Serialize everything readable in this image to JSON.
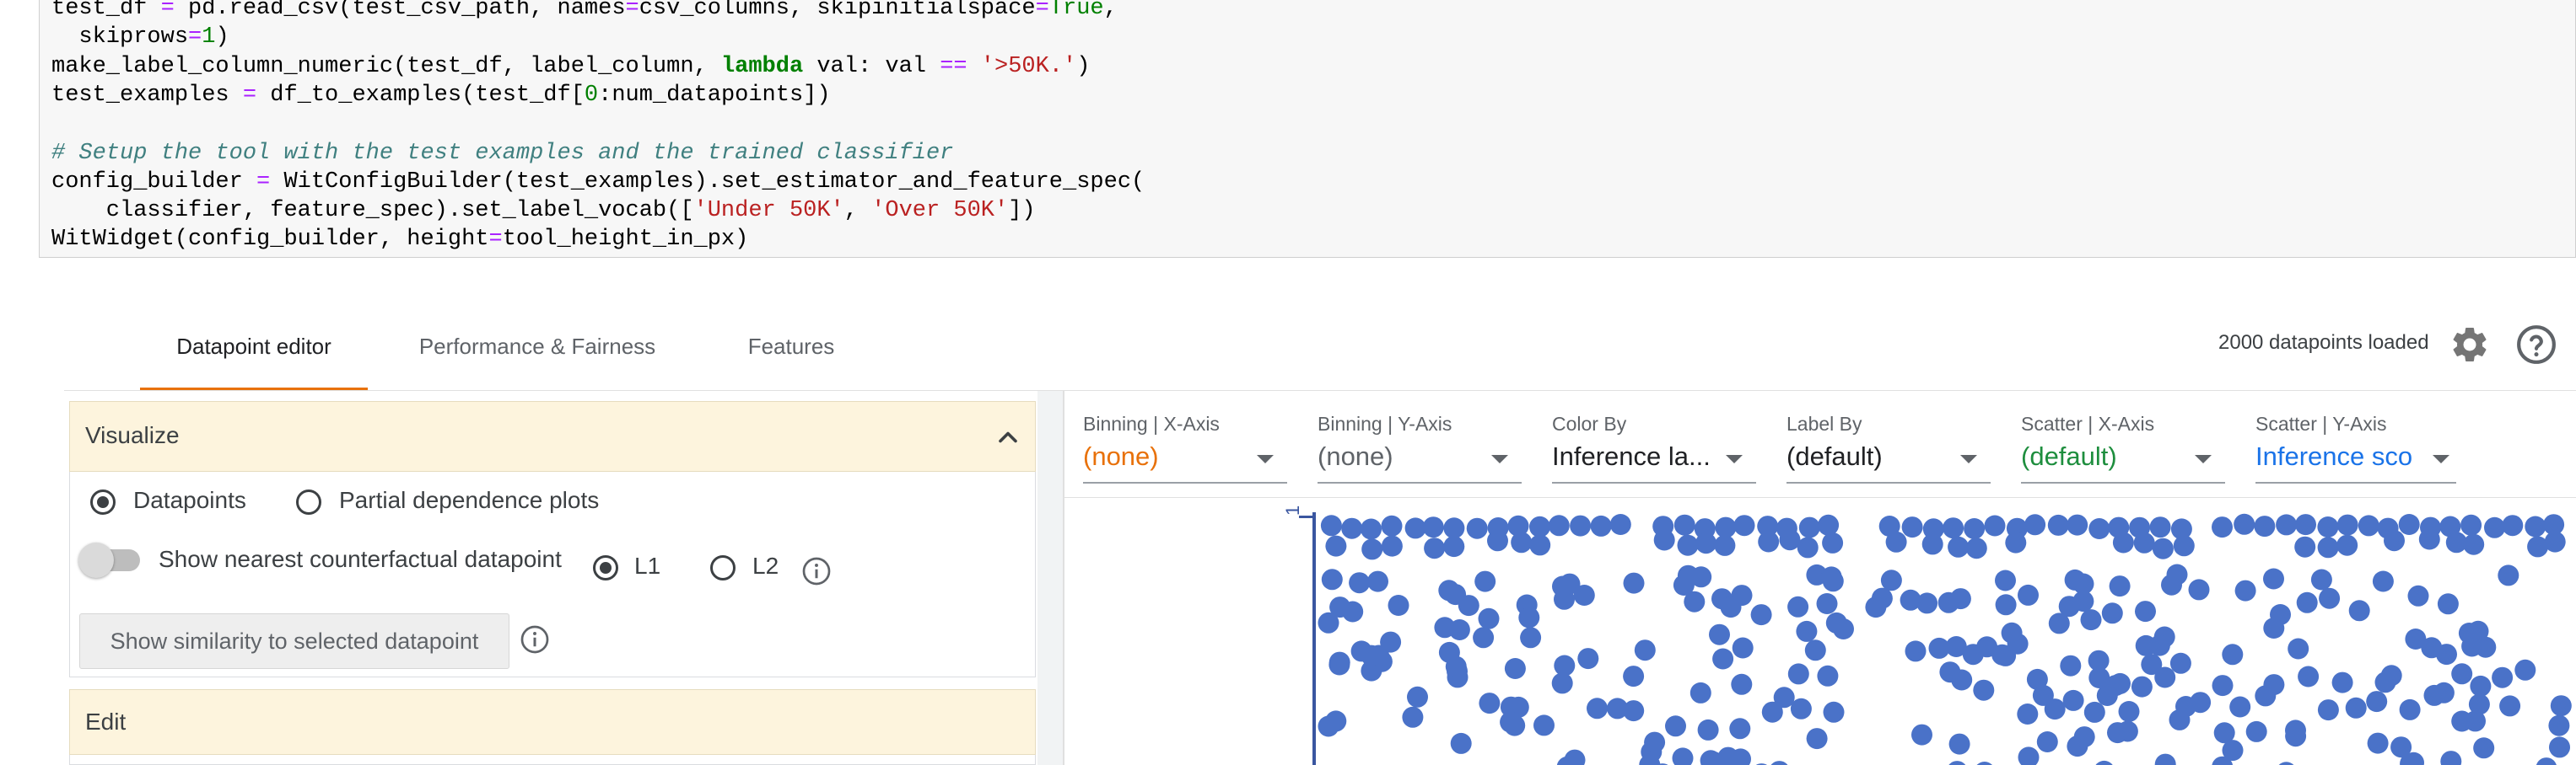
{
  "code": {
    "lines": [
      [
        [
          "",
          "test_df "
        ],
        [
          "op",
          "="
        ],
        [
          "",
          " pd.read_csv(test_csv_path, names"
        ],
        [
          "op",
          "="
        ],
        [
          "",
          "csv_columns, skipinitialspace"
        ],
        [
          "op",
          "="
        ],
        [
          "const",
          "True"
        ],
        [
          "",
          ","
        ]
      ],
      [
        [
          "",
          "  skiprows"
        ],
        [
          "op",
          "="
        ],
        [
          "num",
          "1"
        ],
        [
          "",
          ")"
        ]
      ],
      [
        [
          "",
          "make_label_column_numeric(test_df, label_column, "
        ],
        [
          "kw",
          "lambda"
        ],
        [
          "",
          " val: val "
        ],
        [
          "op",
          "=="
        ],
        [
          "",
          " "
        ],
        [
          "str",
          "'>50K.'"
        ],
        [
          "",
          ")"
        ]
      ],
      [
        [
          "",
          "test_examples "
        ],
        [
          "op",
          "="
        ],
        [
          "",
          " df_to_examples(test_df["
        ],
        [
          "num",
          "0"
        ],
        [
          "",
          ":num_datapoints])"
        ]
      ],
      [
        [
          "",
          ""
        ]
      ],
      [
        [
          "cm",
          "# Setup the tool with the test examples and the trained classifier"
        ]
      ],
      [
        [
          "",
          "config_builder "
        ],
        [
          "op",
          "="
        ],
        [
          "",
          " WitConfigBuilder(test_examples).set_estimator_and_feature_spec("
        ]
      ],
      [
        [
          "",
          "    classifier, feature_spec).set_label_vocab(["
        ],
        [
          "str",
          "'Under 50K'"
        ],
        [
          "",
          ", "
        ],
        [
          "str",
          "'Over 50K'"
        ],
        [
          "",
          "])"
        ]
      ],
      [
        [
          "",
          "WitWidget(config_builder, height"
        ],
        [
          "op",
          "="
        ],
        [
          "",
          "tool_height_in_px)"
        ]
      ]
    ]
  },
  "tabs": [
    {
      "label": "Datapoint editor",
      "active": true
    },
    {
      "label": "Performance & Fairness",
      "active": false
    },
    {
      "label": "Features",
      "active": false
    }
  ],
  "status": {
    "loaded_text": "2000 datapoints loaded"
  },
  "icons": {
    "settings": "gear-icon",
    "help": "help-circle-icon",
    "collapse": "chevron-up-icon",
    "info": "info-icon"
  },
  "visualize": {
    "title": "Visualize",
    "datapoints_label": "Datapoints",
    "datapoints_selected": true,
    "pdp_label": "Partial dependence plots",
    "pdp_selected": false,
    "counterfactual_label": "Show nearest counterfactual datapoint",
    "counterfactual_on": false,
    "l1_label": "L1",
    "l1_selected": true,
    "l2_label": "L2",
    "l2_selected": false,
    "similarity_button": "Show similarity to selected datapoint"
  },
  "edit": {
    "title": "Edit"
  },
  "controls": [
    {
      "label": "Binning | X-Axis",
      "value": "(none)",
      "color": "#e8710a"
    },
    {
      "label": "Binning | Y-Axis",
      "value": "(none)",
      "color": "#5f6368"
    },
    {
      "label": "Color By",
      "value": "Inference la...",
      "color": "#202124"
    },
    {
      "label": "Label By",
      "value": "(default)",
      "color": "#202124"
    },
    {
      "label": "Scatter | X-Axis",
      "value": "(default)",
      "color": "#1e8e3e"
    },
    {
      "label": "Scatter | Y-Axis",
      "value": "Inference sco",
      "color": "#1a73e8"
    }
  ],
  "chart_data": {
    "type": "scatter",
    "y_tick_labels": [
      "1"
    ],
    "point_color": "#4a72c8",
    "points_visible_approx": 230
  },
  "colors": {
    "accent": "#e8710a",
    "section_header_bg": "#fdf4dd",
    "axis": "#3a56a0"
  }
}
